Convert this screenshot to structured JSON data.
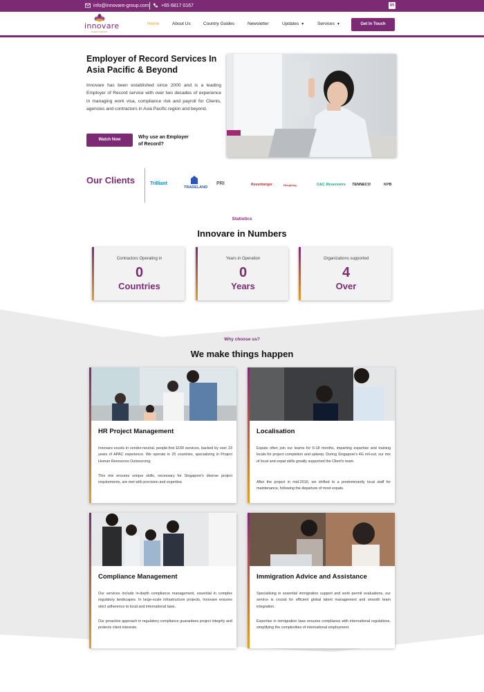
{
  "topbar": {
    "email": "info@innovare-group.com",
    "phone": "+65 6817 0167",
    "linkedin_icon": "linkedin-icon"
  },
  "header": {
    "logo_text": "innovare",
    "logo_tagline": "TALENT GROUP",
    "nav": [
      "Home",
      "About Us",
      "Country Guides",
      "Newsletter",
      "Updates",
      "Services"
    ],
    "active_nav": "Home",
    "cta": "Get In Touch"
  },
  "hero": {
    "title": "Employer of Record Services In Asia Pacific & Beyond",
    "text": "Innovare has been established since 2000 and is a leading Employer of Record service with over two decades of experience in managing work visa, compliance risk and payroll for Clients, agencies and contractors in Asia Pacific region and beyond.",
    "watch_button": "Watch Now",
    "why_link": "Why use an Employer of Record?"
  },
  "clients": {
    "title": "Our Clients",
    "logos": [
      "Trilliant",
      "TRADELAND",
      "PRI",
      "Rosenberger",
      "Hengtong",
      "C&C Reservoirs",
      "TENNECO",
      "KPB"
    ]
  },
  "stats": {
    "eyebrow": "Statistics",
    "title": "Innovare in Numbers",
    "items": [
      {
        "label": "Contractors Operating in",
        "number": "0",
        "unit": "Countries"
      },
      {
        "label": "Years in Operation",
        "number": "0",
        "unit": "Years"
      },
      {
        "label": "Organizations supported",
        "number": "4",
        "unit": "Over"
      }
    ]
  },
  "why": {
    "eyebrow": "Why choose us?",
    "title": "We make things happen",
    "cards": [
      {
        "title": "HR Project Management",
        "p1": "Innovare excels in vendor-neutral, people-first EOR services, backed by over 23 years of APAC experience. We operate in 25 countries, specializing in Project Human Resources Outsourcing.",
        "p2": "This mix ensures unique skills, necessary for Singapore's diverse project requirements, are met with precision and expertise."
      },
      {
        "title": "Localisation",
        "p1": "Expats often join our teams for 6-18 months, imparting expertise and training locals for project completion and upkeep. During Singapore's 4G roll-out, our mix of local and expat skills greatly supported the Client's team.",
        "p2": "After the project in mid-2016, we shifted to a predominantly local staff for maintenance, following the departure of most expats."
      },
      {
        "title": "Compliance Management",
        "p1": "Our services include in-depth compliance management, essential in complex regulatory landscapes. In large-scale infrastructure projects, Innovare ensures strict adherence to local and international laws.",
        "p2": "Our proactive approach in regulatory compliance guarantees project integrity and protects client interests."
      },
      {
        "title": "Immigration Advice  and Assistance",
        "p1": "Specialising in essential immigration support and work permit evaluations, our service is crucial for efficient global talent management and smooth team integration.",
        "p2": "Expertise in immigration laws ensures compliance with international regulations, simplifying the complexities of international employment."
      }
    ]
  },
  "colors": {
    "brand": "#7b2a73",
    "accent": "#e8a020",
    "section_grey": "#ebebeb"
  }
}
